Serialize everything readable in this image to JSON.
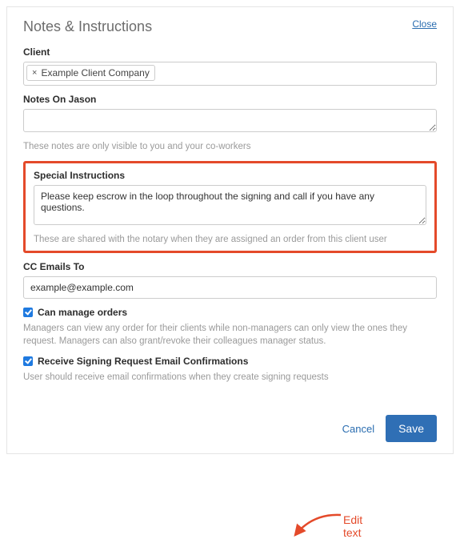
{
  "header": {
    "title": "Notes & Instructions",
    "close": "Close"
  },
  "client": {
    "label": "Client",
    "chip": "Example Client Company"
  },
  "notes_on": {
    "label": "Notes On Jason",
    "hint": "These notes are only visible to you and your co-workers"
  },
  "special": {
    "label": "Special Instructions",
    "value": "Please keep escrow in the loop throughout the signing and call if you have any questions.",
    "hint": "These are shared with the notary when they are assigned an order from this client user"
  },
  "cc": {
    "label": "CC Emails To",
    "value": "example@example.com"
  },
  "manage": {
    "label": "Can manage orders",
    "checked": true,
    "hint": "Managers can view any order for their clients while non-managers can only view the ones they request. Managers can also grant/revoke their colleagues manager status."
  },
  "receive": {
    "label": "Receive Signing Request Email Confirmations",
    "checked": true,
    "hint": "User should receive email confirmations when they create signing requests"
  },
  "footer": {
    "cancel": "Cancel",
    "save": "Save"
  },
  "annotation": {
    "label": "Edit text",
    "color": "#e44a2a"
  }
}
